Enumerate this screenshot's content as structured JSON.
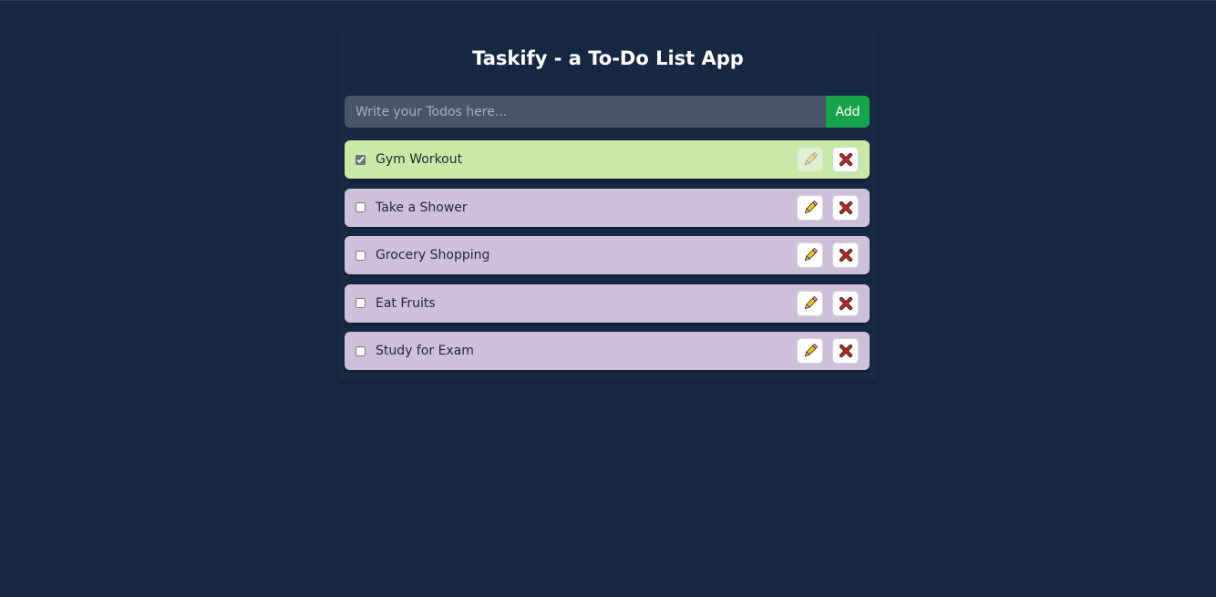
{
  "app": {
    "title": "Taskify - a To-Do List App"
  },
  "input": {
    "placeholder": "Write your Todos here...",
    "value": "",
    "add_label": "Add"
  },
  "todos": [
    {
      "text": "Gym Workout",
      "completed": true
    },
    {
      "text": "Take a Shower",
      "completed": false
    },
    {
      "text": "Grocery Shopping",
      "completed": false
    },
    {
      "text": "Eat Fruits",
      "completed": false
    },
    {
      "text": "Study for Exam",
      "completed": false
    }
  ],
  "icons": {
    "edit": "pencil-icon",
    "delete": "cross-mark-icon"
  },
  "colors": {
    "background": "#172842",
    "todo_pending": "#cfc0da",
    "todo_done": "#c8eaa6",
    "add_button": "#16a34a",
    "input_bg": "#475569"
  }
}
